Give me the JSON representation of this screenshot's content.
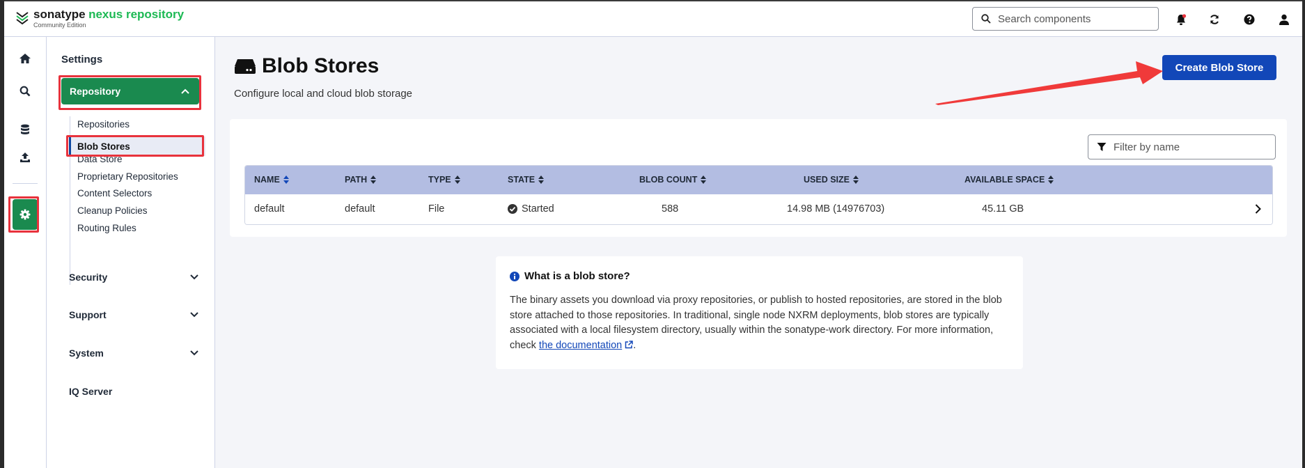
{
  "header": {
    "brand_sonatype": "sonatype",
    "brand_nexus": "nexus repository",
    "brand_edition": "Community Edition",
    "search_placeholder": "Search components"
  },
  "rail": {
    "items": [
      "home-icon",
      "search-icon",
      "database-icon",
      "upload-icon",
      "gear-icon"
    ]
  },
  "sidebar": {
    "title": "Settings",
    "repository_label": "Repository",
    "sub_items": [
      "Repositories",
      "Blob Stores",
      "Data Store",
      "Proprietary Repositories",
      "Content Selectors",
      "Cleanup Policies",
      "Routing Rules"
    ],
    "active_item": "Blob Stores",
    "groups": [
      "Security",
      "Support",
      "System",
      "IQ Server"
    ]
  },
  "main": {
    "title": "Blob Stores",
    "subtitle": "Configure local and cloud blob storage",
    "create_button": "Create Blob Store",
    "filter_placeholder": "Filter by name",
    "columns": [
      "NAME",
      "PATH",
      "TYPE",
      "STATE",
      "BLOB COUNT",
      "USED SIZE",
      "AVAILABLE SPACE"
    ],
    "rows": [
      {
        "name": "default",
        "path": "default",
        "type": "File",
        "state": "Started",
        "blob_count": "588",
        "used_size": "14.98 MB (14976703)",
        "available_space": "45.11 GB"
      }
    ],
    "info": {
      "title": "What is a blob store?",
      "body": "The binary assets you download via proxy repositories, or publish to hosted repositories, are stored in the blob store attached to those repositories. In traditional, single node NXRM deployments, blob stores are typically associated with a local filesystem directory, usually within the sonatype-work directory. For more information, check ",
      "link_text": "the documentation",
      "tail": "."
    }
  },
  "colors": {
    "accent_green": "#1a8a4f",
    "primary_blue": "#1247b8",
    "highlight_red": "#e8323c",
    "table_header": "#b3bde2"
  }
}
